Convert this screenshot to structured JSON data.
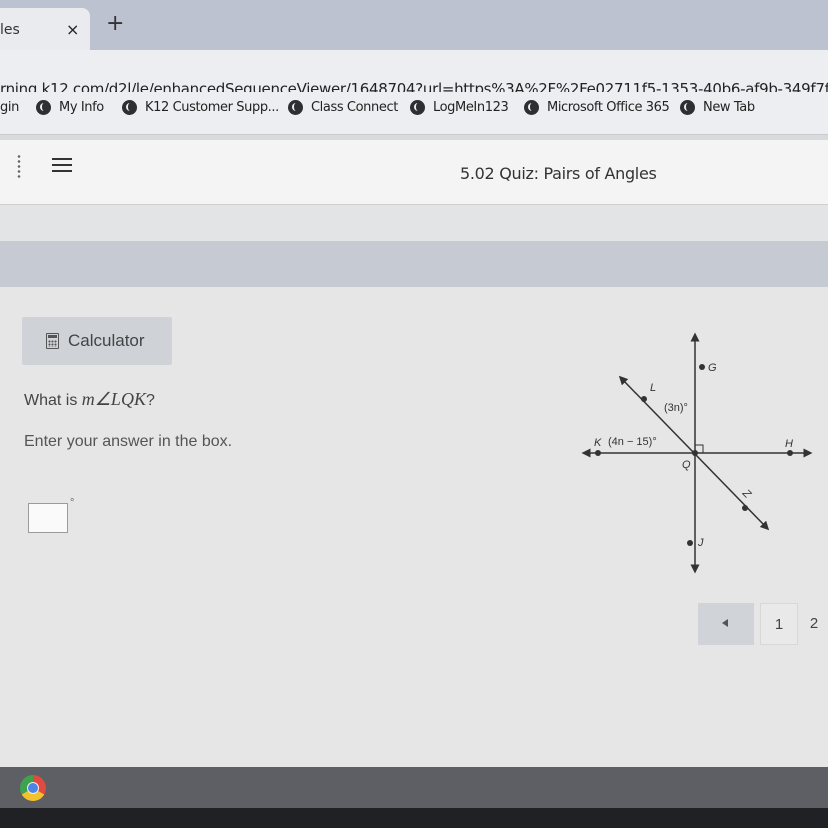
{
  "browser": {
    "tab_title": "les",
    "close_glyph": "×",
    "new_tab_glyph": "+",
    "url": "rning.k12.com/d2l/le/enhancedSequenceViewer/1648704?url=https%3A%2F%2Fe02711f5-1353-40b6-af9b-349f7ff846bd.sequ",
    "bookmarks": [
      {
        "label": "gin",
        "icon": ""
      },
      {
        "label": "My Info",
        "icon": "globe-icon"
      },
      {
        "label": "K12 Customer Supp...",
        "icon": "globe-icon"
      },
      {
        "label": "Class Connect",
        "icon": "globe-icon"
      },
      {
        "label": "LogMeIn123",
        "icon": "globe-icon"
      },
      {
        "label": "Microsoft Office 365",
        "icon": "globe-icon"
      },
      {
        "label": "New Tab",
        "icon": "globe-icon"
      }
    ]
  },
  "course": {
    "title": "5.02 Quiz: Pairs of Angles"
  },
  "question": {
    "calculator_label": "Calculator",
    "prompt_prefix": "What is ",
    "prompt_math": "m∠LQK",
    "prompt_suffix": "?",
    "instruction": "Enter your answer in the box.",
    "answer_value": "",
    "degree_symbol": "°"
  },
  "diagram": {
    "labels": {
      "G": "G",
      "L": "L",
      "K": "K",
      "H": "H",
      "Q": "Q",
      "Z": "Z",
      "J": "J"
    },
    "angle_3n": "(3n)°",
    "angle_4n": "(4n − 15)°"
  },
  "pagination": {
    "pages": [
      "1",
      "2"
    ]
  },
  "colors": {
    "tab_strip": "#bcc2cf",
    "content_bg": "#e6e6e6",
    "band": "#c6cad3"
  }
}
